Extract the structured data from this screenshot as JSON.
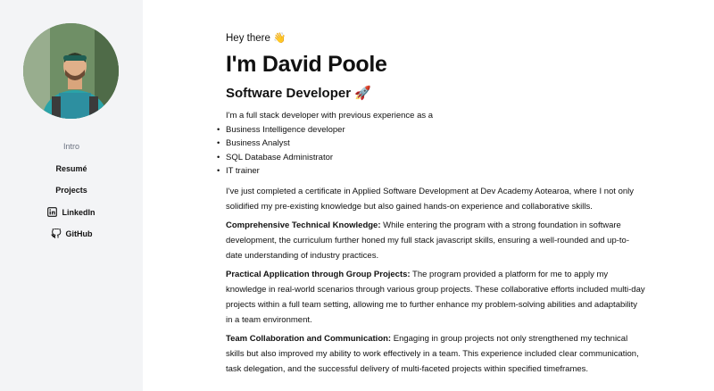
{
  "profile": {
    "avatar_alt": "David Poole portrait"
  },
  "nav": {
    "intro": "Intro",
    "resume": "Resumé",
    "projects": "Projects",
    "linkedin": "LinkedIn",
    "github": "GitHub"
  },
  "main": {
    "greeting": "Hey there 👋",
    "name": "I'm David Poole",
    "role": "Software Developer 🚀",
    "intro": "I'm a full stack developer with previous experience as a",
    "experience": [
      "Business Intelligence developer",
      "Business Analyst",
      "SQL Database Administrator",
      "IT trainer"
    ],
    "certificate": "I've just completed a certificate in Applied Software Development at Dev Academy Aotearoa, where I not only solidified my pre-existing knowledge but also gained hands-on experience and collaborative skills.",
    "sections": [
      {
        "heading": "Comprehensive Technical Knowledge:",
        "text": " While entering the program with a strong foundation in software development, the curriculum further honed my full stack javascript skills, ensuring a well-rounded and up-to-date understanding of industry practices."
      },
      {
        "heading": "Practical Application through Group Projects:",
        "text": " The program provided a platform for me to apply my knowledge in real-world scenarios through various group projects. These collaborative efforts included multi-day projects within a full team setting, allowing me to further enhance my problem-solving abilities and adaptability in a team environment."
      },
      {
        "heading": "Team Collaboration and Communication:",
        "text": " Engaging in group projects not only strengthened my technical skills but also improved my ability to work effectively in a team. This experience included clear communication, task delegation, and the successful delivery of multi-faceted projects within specified timeframes."
      }
    ]
  }
}
